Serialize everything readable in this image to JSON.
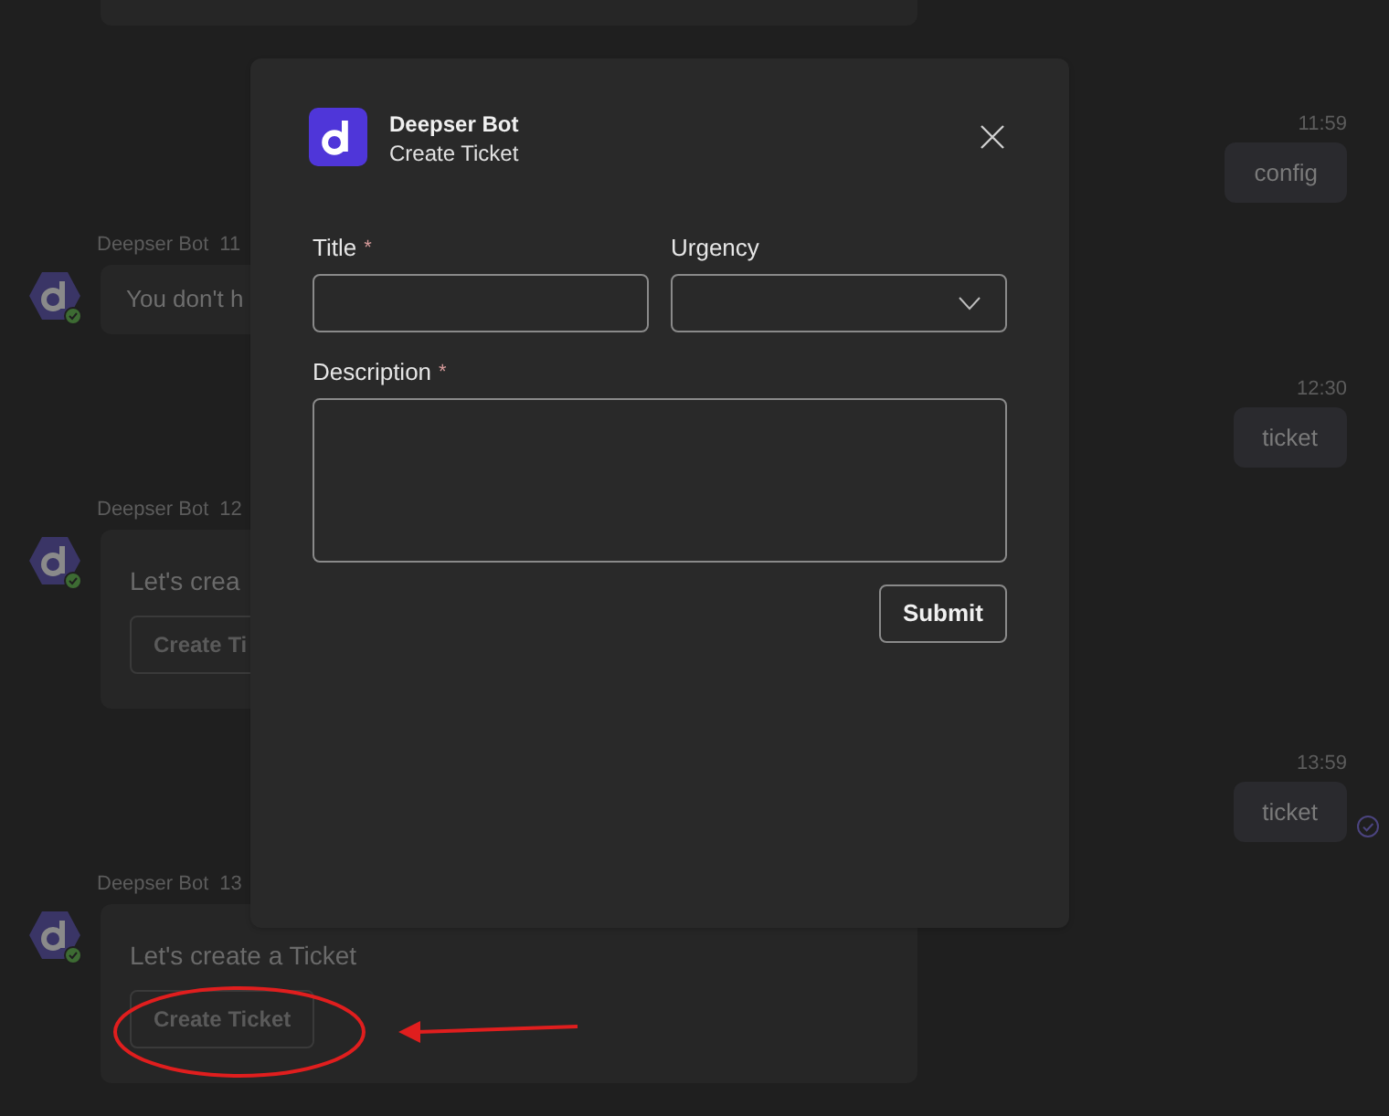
{
  "chat": {
    "messages": [
      {
        "kind": "user",
        "time": "11:59",
        "text": "config",
        "seen": false
      },
      {
        "kind": "bot_text",
        "sender": "Deepser Bot",
        "time": "11",
        "text": "You don't h"
      },
      {
        "kind": "user",
        "time": "12:30",
        "text": "ticket",
        "seen": false
      },
      {
        "kind": "bot_card",
        "sender": "Deepser Bot",
        "time": "12",
        "text": "Let's crea",
        "button": "Create Ti"
      },
      {
        "kind": "user",
        "time": "13:59",
        "text": "ticket",
        "seen": true
      },
      {
        "kind": "bot_card",
        "sender": "Deepser Bot",
        "time": "13",
        "text": "Let's create a Ticket",
        "button": "Create Ticket"
      }
    ]
  },
  "dialog": {
    "app_name": "Deepser Bot",
    "subtitle": "Create Ticket",
    "fields": [
      {
        "kind": "text",
        "label": "Title",
        "required_mark": "*"
      },
      {
        "kind": "select",
        "label": "Urgency"
      },
      {
        "kind": "textarea",
        "label": "Description",
        "required_mark": "*"
      }
    ],
    "submit": "Submit"
  }
}
